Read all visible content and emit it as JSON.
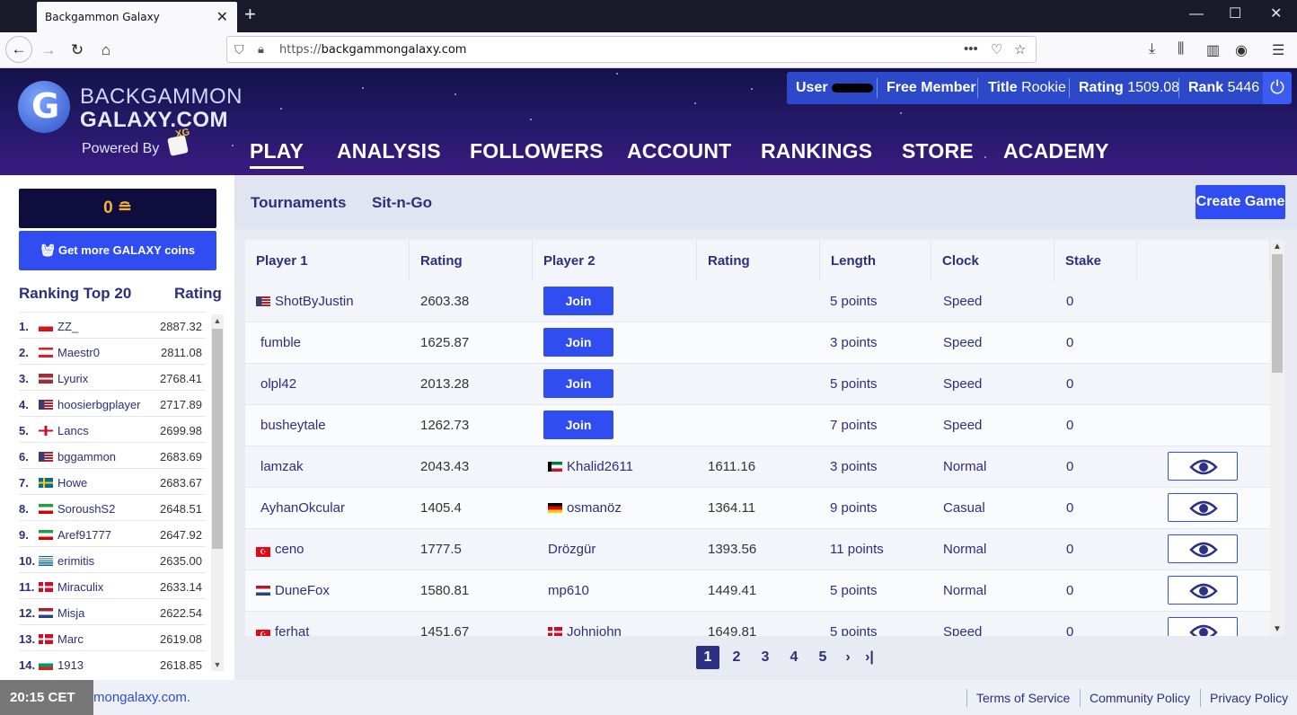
{
  "browser": {
    "tab_title": "Backgammon Galaxy",
    "url_prefix": "https://",
    "url_host": "backgammongalaxy.com"
  },
  "header": {
    "logo_line1": "BACKGAMMON",
    "logo_line2": "GALAXY.COM",
    "powered_by": "Powered By",
    "nav": [
      "PLAY",
      "ANALYSIS",
      "FOLLOWERS",
      "ACCOUNT",
      "RANKINGS",
      "STORE",
      "ACADEMY"
    ],
    "active_nav": "PLAY"
  },
  "user": {
    "user_label": "User",
    "membership": "Free Member",
    "title_label": "Title",
    "title_value": "Rookie",
    "rating_label": "Rating",
    "rating_value": "1509.08",
    "rank_label": "Rank",
    "rank_value": "5446"
  },
  "sidebar": {
    "coins": "0",
    "get_coins_label": "Get more GALAXY coins",
    "ranking_title": "Ranking Top 20",
    "rating_header": "Rating",
    "rankings": [
      {
        "num": "1.",
        "flag": "cz",
        "name": "ZZ_",
        "rating": "2887.32"
      },
      {
        "num": "2.",
        "flag": "lb",
        "name": "Maestr0",
        "rating": "2811.08"
      },
      {
        "num": "3.",
        "flag": "lv",
        "name": "Lyurix",
        "rating": "2768.41"
      },
      {
        "num": "4.",
        "flag": "us",
        "name": "hoosierbgplayer",
        "rating": "2717.89"
      },
      {
        "num": "5.",
        "flag": "gb",
        "name": "Lancs",
        "rating": "2699.98"
      },
      {
        "num": "6.",
        "flag": "us",
        "name": "bggammon",
        "rating": "2683.69"
      },
      {
        "num": "7.",
        "flag": "se",
        "name": "Howe",
        "rating": "2683.67"
      },
      {
        "num": "8.",
        "flag": "ir",
        "name": "SoroushS2",
        "rating": "2648.51"
      },
      {
        "num": "9.",
        "flag": "ir",
        "name": "Aref91777",
        "rating": "2647.92"
      },
      {
        "num": "10.",
        "flag": "gr",
        "name": "erimitis",
        "rating": "2635.00"
      },
      {
        "num": "11.",
        "flag": "dk",
        "name": "Miraculix",
        "rating": "2633.14"
      },
      {
        "num": "12.",
        "flag": "nl",
        "name": "Misja",
        "rating": "2622.54"
      },
      {
        "num": "13.",
        "flag": "dk",
        "name": "Marc",
        "rating": "2619.08"
      },
      {
        "num": "14.",
        "flag": "bg",
        "name": "1913",
        "rating": "2618.85"
      }
    ]
  },
  "subnav": {
    "tournaments": "Tournaments",
    "sitngo": "Sit-n-Go",
    "create_game": "Create Game"
  },
  "games": {
    "headers": [
      "Player 1",
      "Rating",
      "Player 2",
      "Rating",
      "Length",
      "Clock",
      "Stake",
      ""
    ],
    "join_label": "Join",
    "rows": [
      {
        "p1": "ShotByJustin",
        "p1_flag": "us",
        "r1": "2603.38",
        "p2": "",
        "p2_flag": "",
        "r2": "",
        "length": "5 points",
        "clock": "Speed",
        "stake": "0",
        "action": "join"
      },
      {
        "p1": "fumble",
        "p1_flag": "",
        "r1": "1625.87",
        "p2": "",
        "p2_flag": "",
        "r2": "",
        "length": "3 points",
        "clock": "Speed",
        "stake": "0",
        "action": "join"
      },
      {
        "p1": "olpl42",
        "p1_flag": "",
        "r1": "2013.28",
        "p2": "",
        "p2_flag": "",
        "r2": "",
        "length": "5 points",
        "clock": "Speed",
        "stake": "0",
        "action": "join"
      },
      {
        "p1": "busheytale",
        "p1_flag": "",
        "r1": "1262.73",
        "p2": "",
        "p2_flag": "",
        "r2": "",
        "length": "7 points",
        "clock": "Speed",
        "stake": "0",
        "action": "join"
      },
      {
        "p1": "lamzak",
        "p1_flag": "",
        "r1": "2043.43",
        "p2": "Khalid2611",
        "p2_flag": "kw",
        "r2": "1611.16",
        "length": "3 points",
        "clock": "Normal",
        "stake": "0",
        "action": "watch"
      },
      {
        "p1": "AyhanOkcular",
        "p1_flag": "",
        "r1": "1405.4",
        "p2": "osmanöz",
        "p2_flag": "de",
        "r2": "1364.11",
        "length": "9 points",
        "clock": "Casual",
        "stake": "0",
        "action": "watch"
      },
      {
        "p1": "ceno",
        "p1_flag": "tr",
        "r1": "1777.5",
        "p2": "Drözgür",
        "p2_flag": "",
        "r2": "1393.56",
        "length": "11 points",
        "clock": "Normal",
        "stake": "0",
        "action": "watch"
      },
      {
        "p1": "DuneFox",
        "p1_flag": "nl",
        "r1": "1580.81",
        "p2": "mp610",
        "p2_flag": "",
        "r2": "1449.41",
        "length": "5 points",
        "clock": "Normal",
        "stake": "0",
        "action": "watch"
      },
      {
        "p1": "ferhat",
        "p1_flag": "tr",
        "r1": "1451.67",
        "p2": "Johnjohn",
        "p2_flag": "dk",
        "r2": "1649.81",
        "length": "5 points",
        "clock": "Speed",
        "stake": "0",
        "action": "watch"
      }
    ]
  },
  "pagination": {
    "pages": [
      "1",
      "2",
      "3",
      "4",
      "5"
    ],
    "current": "1",
    "next": "›",
    "last": "›|"
  },
  "footer": {
    "clock": "20:15 CET",
    "url_fragment": "mongalaxy.com.",
    "links": [
      "Terms of Service",
      "Community Policy",
      "Privacy Policy"
    ]
  },
  "colors": {
    "brand_blue": "#2f4df1",
    "navy_text": "#2c2f7a",
    "header_purple": "#25196a",
    "coin_gold": "#f3b43a"
  }
}
